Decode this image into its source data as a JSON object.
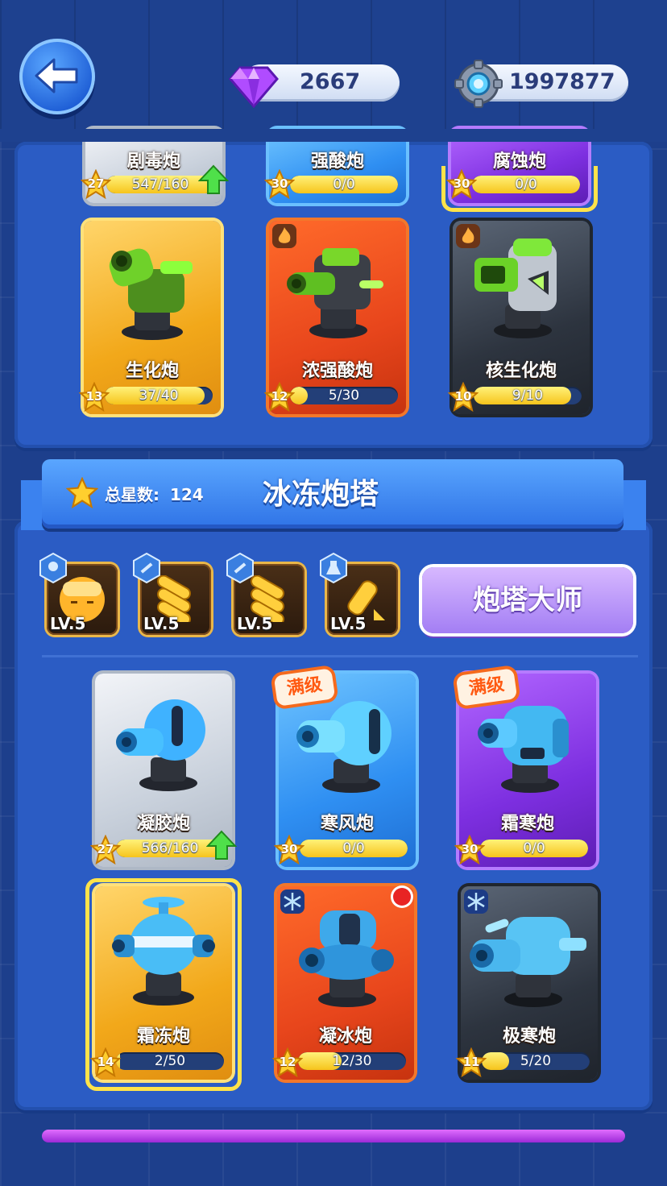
{
  "currency": {
    "gems": "2667",
    "gold": "1997877",
    "gem_icon": "purple-gem-icon",
    "gear_icon": "gear-coin-icon"
  },
  "top_partial_cards": [
    {
      "name": "剧毒炮",
      "stars": "27",
      "progress": "547/160",
      "fill": 1.0,
      "upgrade": true
    },
    {
      "name": "强酸炮",
      "stars": "30",
      "progress": "0/0",
      "fill": 1.0,
      "upgrade": false
    },
    {
      "name": "腐蚀炮",
      "stars": "30",
      "progress": "0/0",
      "fill": 1.0,
      "upgrade": false
    }
  ],
  "poison_cards": [
    {
      "name": "生化炮",
      "stars": "13",
      "progress": "37/40",
      "fill": 0.925
    },
    {
      "name": "浓强酸炮",
      "stars": "12",
      "progress": "5/30",
      "fill": 0.1667
    },
    {
      "name": "核生化炮",
      "stars": "10",
      "progress": "9/10",
      "fill": 0.9
    }
  ],
  "ice_section": {
    "total_stars_label": "总星数:",
    "total_stars": "124",
    "title": "冰冻炮塔",
    "master_button": "炮塔大师",
    "skills": [
      {
        "level": "LV.5",
        "icon": "character-face-icon"
      },
      {
        "level": "LV.5",
        "icon": "ammo-shells-icon"
      },
      {
        "level": "LV.5",
        "icon": "ammo-shells-icon"
      },
      {
        "level": "LV.5",
        "icon": "frost-bottle-icon"
      }
    ]
  },
  "ice_cards_row1": [
    {
      "name": "凝胶炮",
      "stars": "27",
      "progress": "566/160",
      "fill": 1.0,
      "badge": "",
      "upgrade": true
    },
    {
      "name": "寒风炮",
      "stars": "30",
      "progress": "0/0",
      "fill": 1.0,
      "badge": "满级",
      "upgrade": false
    },
    {
      "name": "霜寒炮",
      "stars": "30",
      "progress": "0/0",
      "fill": 1.0,
      "badge": "满级",
      "upgrade": false
    }
  ],
  "ice_cards_row2": [
    {
      "name": "霜冻炮",
      "stars": "14",
      "progress": "2/50",
      "fill": 0.04
    },
    {
      "name": "凝冰炮",
      "stars": "12",
      "progress": "12/30",
      "fill": 0.4
    },
    {
      "name": "极寒炮",
      "stars": "11",
      "progress": "5/20",
      "fill": 0.25
    }
  ]
}
